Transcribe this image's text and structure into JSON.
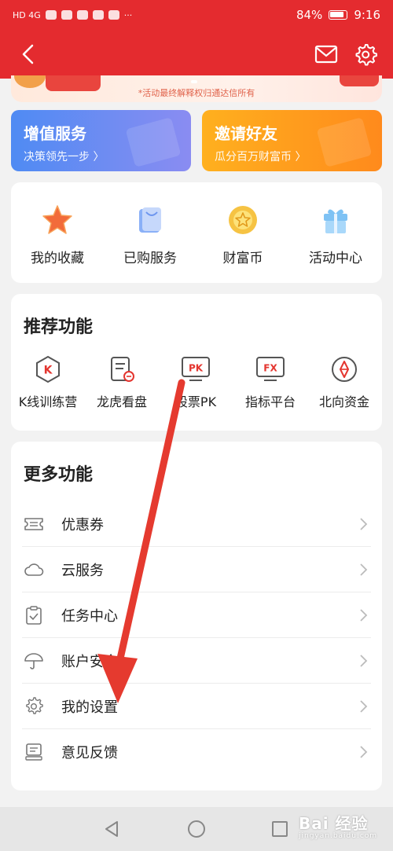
{
  "status_bar": {
    "network": "HD 4G",
    "battery": "84%",
    "time": "9:16"
  },
  "header": {
    "back_icon": "chevron-left-icon",
    "mail_icon": "mail-icon",
    "settings_icon": "gear-icon"
  },
  "banner": {
    "note": "*活动最终解释权归通达信所有"
  },
  "promos": [
    {
      "title": "增值服务",
      "subtitle": "决策领先一步 〉",
      "color": "#4f8bf3"
    },
    {
      "title": "邀请好友",
      "subtitle": "瓜分百万财富币 〉",
      "color": "#ff9a1c"
    }
  ],
  "quick_actions": [
    {
      "label": "我的收藏",
      "icon": "star-icon"
    },
    {
      "label": "已购服务",
      "icon": "shopping-bag-icon"
    },
    {
      "label": "财富币",
      "icon": "coin-icon"
    },
    {
      "label": "活动中心",
      "icon": "gift-icon"
    }
  ],
  "recommended": {
    "title": "推荐功能",
    "items": [
      {
        "label": "K线训练营",
        "icon": "k-line-icon",
        "glyph": "K"
      },
      {
        "label": "龙虎看盘",
        "icon": "document-icon",
        "glyph": ""
      },
      {
        "label": "股票PK",
        "icon": "pk-icon",
        "glyph": "PK"
      },
      {
        "label": "指标平台",
        "icon": "fx-icon",
        "glyph": "FX"
      },
      {
        "label": "北向资金",
        "icon": "compass-icon",
        "glyph": ""
      }
    ]
  },
  "more": {
    "title": "更多功能",
    "items": [
      {
        "label": "优惠券",
        "icon": "ticket-icon"
      },
      {
        "label": "云服务",
        "icon": "cloud-icon"
      },
      {
        "label": "任务中心",
        "icon": "clipboard-icon"
      },
      {
        "label": "账户安全",
        "icon": "umbrella-icon"
      },
      {
        "label": "我的设置",
        "icon": "gear-icon"
      },
      {
        "label": "意见反馈",
        "icon": "feedback-icon"
      }
    ]
  },
  "bottom_nav": {
    "back": "triangle-back-icon",
    "home": "circle-home-icon",
    "recents": "square-recents-icon"
  },
  "watermark": {
    "text": "Bai 经验",
    "sub": "jingyan.baidu.com"
  },
  "colors": {
    "header_red": "#e42b2f",
    "annotation_arrow": "#e53a2f",
    "promo_blue": "#4f8bf3",
    "promo_orange": "#ff9a1c"
  }
}
